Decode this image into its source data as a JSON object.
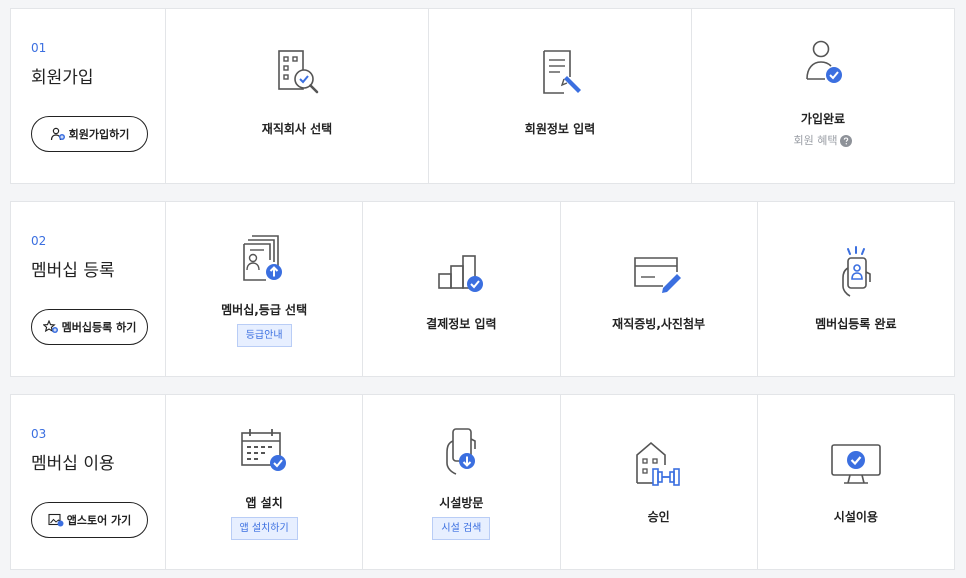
{
  "sections": [
    {
      "number": "01",
      "title": "회원가입",
      "button_label": "회원가입하기",
      "steps": [
        {
          "label": "재직회사 선택",
          "icon": "building-search-icon"
        },
        {
          "label": "회원정보 입력",
          "icon": "document-edit-icon"
        },
        {
          "label": "가입완료",
          "icon": "user-check-icon",
          "link": "회원 혜택"
        }
      ]
    },
    {
      "number": "02",
      "title": "멤버십 등록",
      "button_label": "멤버십등록 하기",
      "steps": [
        {
          "label": "멤버십,등급 선택",
          "icon": "documents-upload-icon",
          "tag": "등급안내"
        },
        {
          "label": "결제정보 입력",
          "icon": "bars-check-icon"
        },
        {
          "label": "재직증빙,사진첨부",
          "icon": "card-edit-icon"
        },
        {
          "label": "멤버십등록 완료",
          "icon": "phone-hand-icon"
        }
      ]
    },
    {
      "number": "03",
      "title": "멤버십 이용",
      "button_label": "앱스토어 가기",
      "steps": [
        {
          "label": "앱 설치",
          "icon": "calendar-check-icon",
          "tag": "앱 설치하기"
        },
        {
          "label": "시설방문",
          "icon": "phone-download-icon",
          "tag": "시설 검색"
        },
        {
          "label": "승인",
          "icon": "gym-building-icon"
        },
        {
          "label": "시설이용",
          "icon": "monitor-check-icon"
        }
      ]
    }
  ],
  "colors": {
    "accent": "#3b6fe0",
    "icon_stroke": "#555555",
    "tag_bg": "#e7efff"
  }
}
